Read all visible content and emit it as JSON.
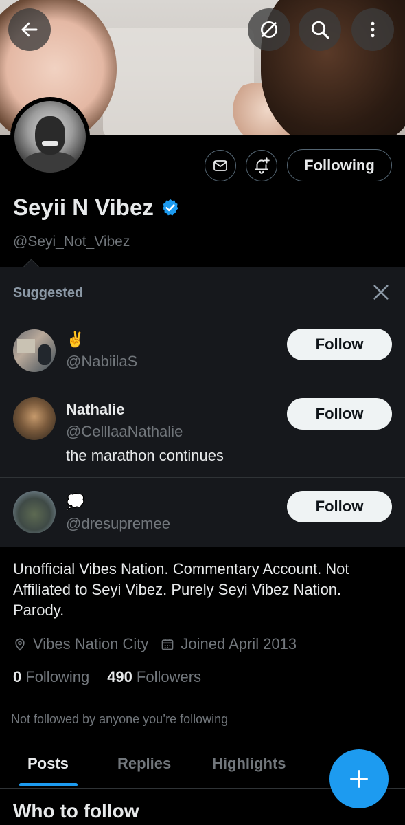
{
  "profile": {
    "name": "Seyii N Vibez",
    "handle": "@Seyi_Not_Vibez",
    "following_button": "Following",
    "bio": "Unofficial Vibes Nation. Commentary Account. Not Affiliated to Seyi Vibez. Purely Seyi Vibez Nation. Parody.",
    "location": "Vibes Nation City",
    "joined": "Joined April 2013",
    "following_count": "0",
    "following_label": "Following",
    "followers_count": "490",
    "followers_label": "Followers",
    "not_followed_note": "Not followed by anyone you’re following"
  },
  "suggested": {
    "title": "Suggested",
    "users": [
      {
        "name": "✌️",
        "handle": "@NabiilaS",
        "bio": "",
        "button": "Follow"
      },
      {
        "name": "Nathalie",
        "handle": "@CelllaaNathalie",
        "bio": "the marathon continues",
        "button": "Follow"
      },
      {
        "name": "💭",
        "handle": "@dresupremee",
        "bio": "",
        "button": "Follow"
      }
    ]
  },
  "tabs": [
    "Posts",
    "Replies",
    "Highlights"
  ],
  "who_to_follow": "Who to follow",
  "icons": {
    "back": "back-arrow-icon",
    "stop": "stop-circle-icon",
    "search": "search-icon",
    "more": "more-vertical-icon",
    "message": "mail-icon",
    "notify": "bell-plus-icon",
    "verified": "verified-badge-icon",
    "close": "close-icon",
    "location": "location-pin-icon",
    "calendar": "calendar-icon",
    "compose": "plus-icon"
  },
  "colors": {
    "accent": "#1d9bf0",
    "background": "#000000",
    "panel": "#16181c",
    "muted": "#71767b"
  }
}
